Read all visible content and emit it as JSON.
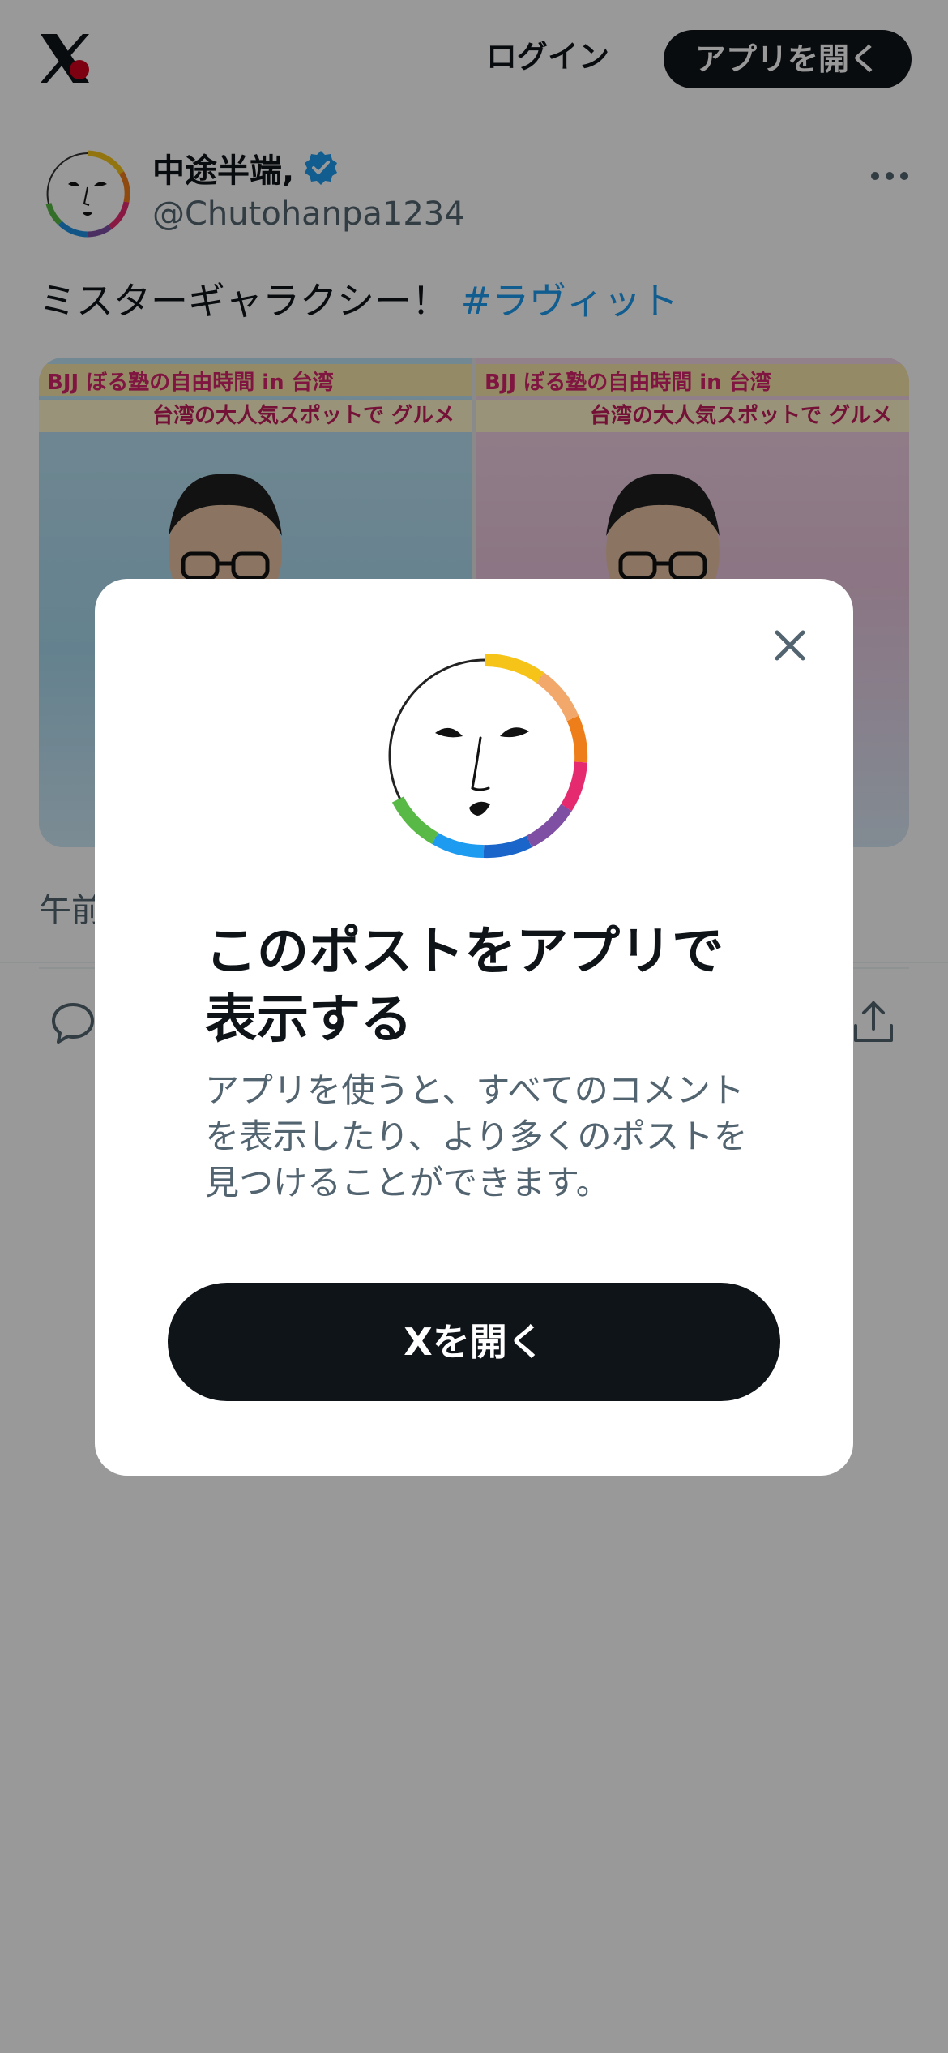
{
  "header": {
    "logo_icon": "x-logo-icon",
    "login_label": "ログイン",
    "open_app_label": "アプリを開く"
  },
  "post": {
    "display_name": "中途半端,",
    "handle": "@Chutohanpa1234",
    "text": "ミスターギャラクシー！",
    "hashtag": "#ラヴィット",
    "time_prefix": "午前",
    "media": [
      {
        "caption_title": "BJJ ぼる塾の自由時間 in 台湾",
        "caption_sub": "台湾の大人気スポットで グルメ"
      },
      {
        "caption_title": "BJJ ぼる塾の自由時間 in 台湾",
        "caption_sub": "台湾の大人気スポットで グルメ"
      }
    ]
  },
  "modal": {
    "title": "このポストをアプリで表示する",
    "body": "アプリを使うと、すべてのコメントを表示したり、より多くのポストを見つけることができます。",
    "cta_label": "Xを開く"
  },
  "colors": {
    "accent": "#1d9bf0",
    "button_dark": "#0f1419",
    "secondary_text": "#536471",
    "overlay": "rgba(0,0,0,0.4)"
  }
}
